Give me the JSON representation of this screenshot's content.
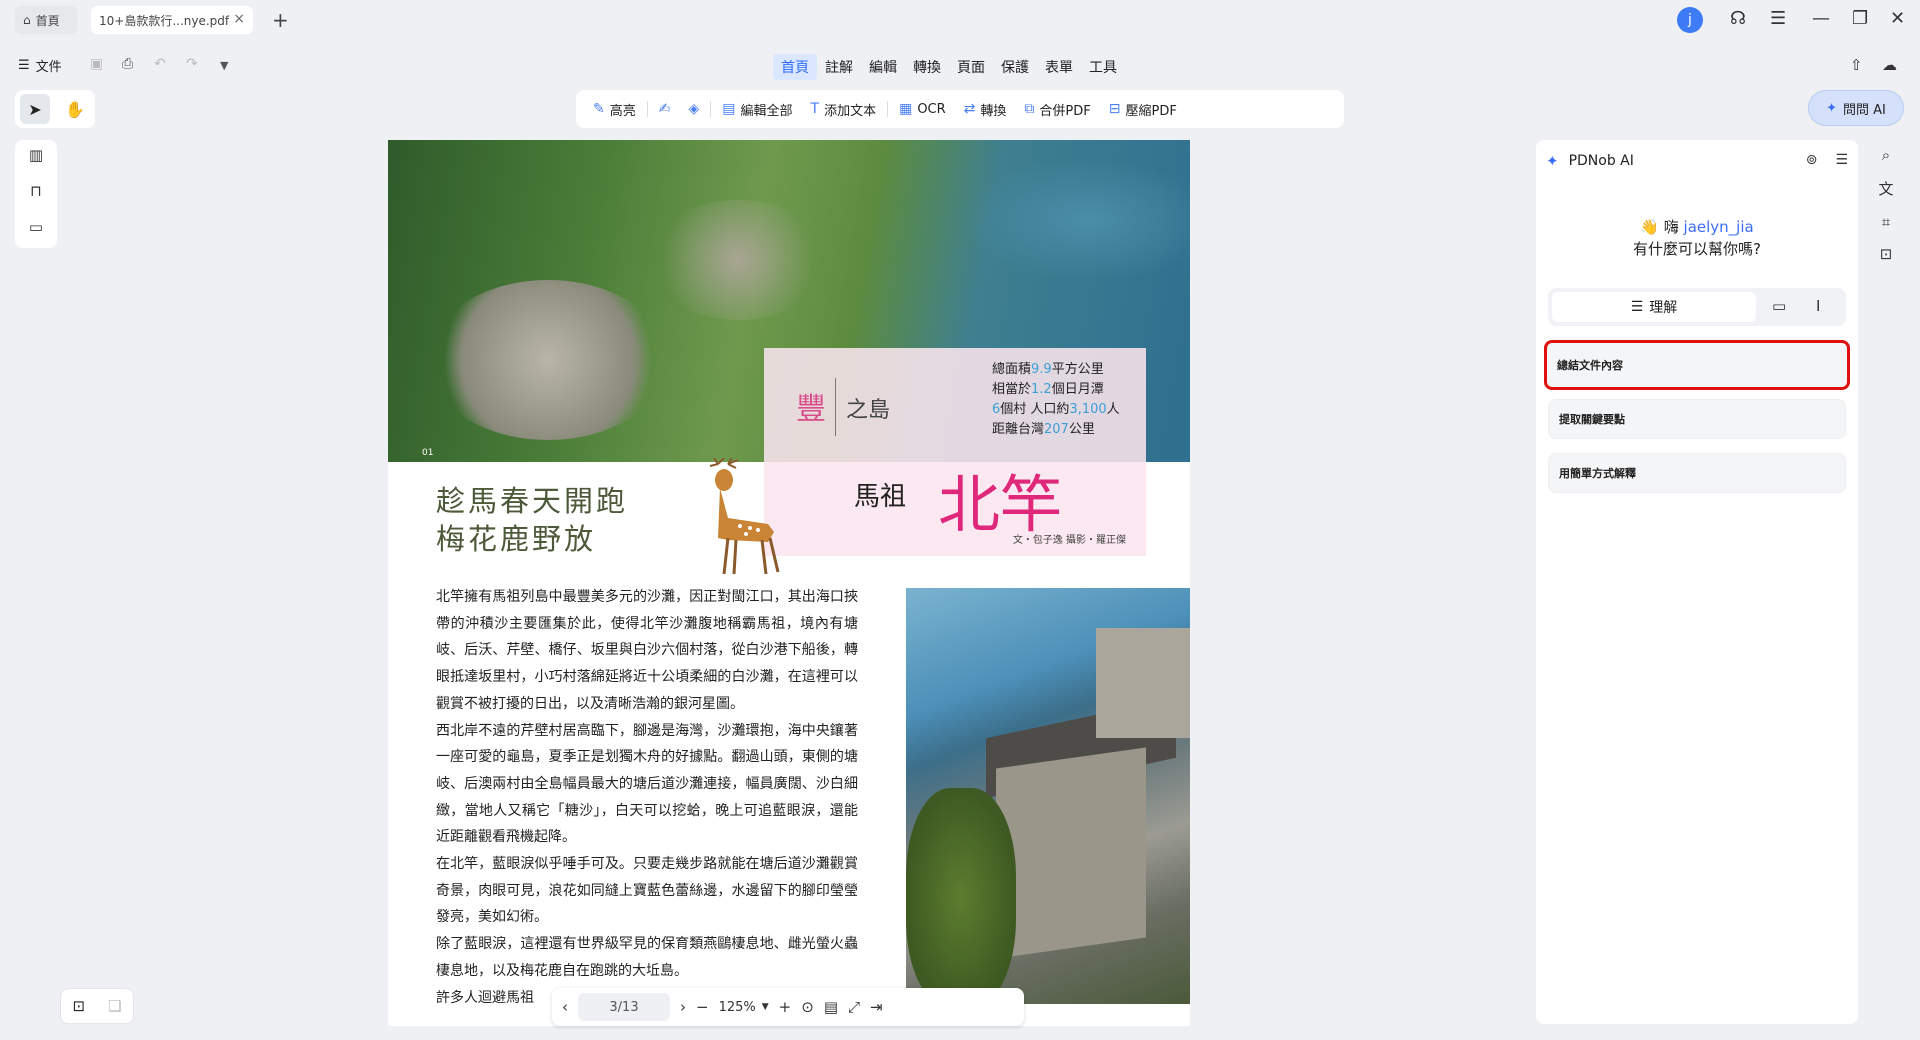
{
  "tabs": {
    "home_label": "首頁",
    "doc_label": "10+島款款行...nye.pdf",
    "close": "×",
    "new_tab": "+"
  },
  "window": {
    "avatar_letter": "j",
    "support_icon": "headset-icon",
    "menu_icon": "hamburger-icon",
    "minimize_icon": "minimize-icon",
    "restore_icon": "restore-icon",
    "close_icon": "close-icon"
  },
  "file_menu": {
    "label": "文件"
  },
  "menu": {
    "items": [
      "首頁",
      "註解",
      "編輯",
      "轉換",
      "頁面",
      "保護",
      "表單",
      "工具"
    ],
    "active": "首頁"
  },
  "toolbar": {
    "highlight": "高亮",
    "edit_all": "編輯全部",
    "add_text": "添加文本",
    "ocr": "OCR",
    "convert": "轉換",
    "merge": "合併PDF",
    "compress": "壓縮PDF"
  },
  "ask_ai": {
    "label": "問問 AI"
  },
  "document": {
    "page_marker": "01",
    "feng": "豐",
    "zhidao": "之島",
    "facts": [
      {
        "pre": "總面積",
        "hl": "9.9",
        "post": "平方公里"
      },
      {
        "pre": "相當於",
        "hl": "1.2",
        "post": "個日月潭"
      },
      {
        "pre": "",
        "hl": "6",
        "post": "個村 人口約",
        "hl2": "3,100",
        "post2": "人"
      },
      {
        "pre": "距離台灣",
        "hl": "207",
        "post": "公里"
      }
    ],
    "title_small": "馬祖",
    "title_big": "北竿",
    "credit": "文・包子逸  攝影・羅正傑",
    "headline_1": "趁馬春天開跑",
    "headline_2": "梅花鹿野放",
    "paragraphs": [
      "北竿擁有馬祖列島中最豐美多元的沙灘，因正對閩江口，其出海口挾帶的沖積沙主要匯集於此，使得北竿沙灘腹地稱霸馬祖，境內有塘岐、后沃、芹壁、橋仔、坂里與白沙六個村落，從白沙港下船後，轉眼抵達坂里村，小巧村落綿延將近十公頃柔細的白沙灘，在這裡可以觀賞不被打擾的日出，以及清晰浩瀚的銀河星圖。",
      "西北岸不遠的芹壁村居高臨下，腳邊是海灣，沙灘環抱，海中央鑲著一座可愛的龜島，夏季正是划獨木舟的好據點。翻過山頭，東側的塘岐、后澳兩村由全島幅員最大的塘后道沙灘連接，幅員廣闊、沙白細緻，當地人又稱它「糖沙」，白天可以挖蛤，晚上可追藍眼淚，還能近距離觀看飛機起降。",
      "在北竿，藍眼淚似乎唾手可及。只要走幾步路就能在塘后道沙灘觀賞奇景，肉眼可見，浪花如同縫上寶藍色蕾絲邊，水邊留下的腳印瑩瑩發亮，美如幻術。",
      "除了藍眼淚，這裡還有世界級罕見的保育類燕鷗棲息地、雌光螢火蟲棲息地，以及梅花鹿自在跑跳的大坵島。",
      "許多人迴避馬祖"
    ]
  },
  "page_nav": {
    "current": "3/13",
    "zoom": "125%"
  },
  "ai_panel": {
    "title": "PDNob AI",
    "greeting_hi": "嗨",
    "user": "jaelyn_jia",
    "greeting_q": "有什麼可以幫你嗎?",
    "tab_understand": "理解",
    "options": [
      "總結文件內容",
      "提取關鍵要點",
      "用簡單方式解釋"
    ]
  },
  "colors": {
    "accent": "#2f6cf6",
    "highlight_red": "#e01010",
    "title_pink": "#e0287a"
  }
}
